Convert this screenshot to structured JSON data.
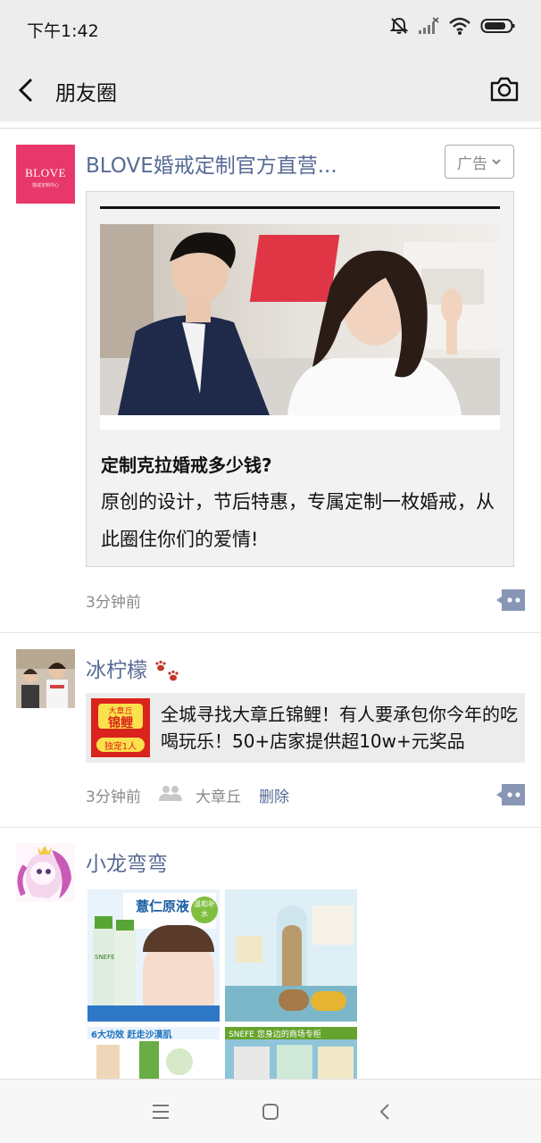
{
  "status_bar": {
    "time": "下午1:42",
    "icons": [
      "mute-bell-icon",
      "signal-icon",
      "wifi-icon",
      "battery-icon"
    ]
  },
  "nav": {
    "title": "朋友圈",
    "back_icon": "chevron-left-icon",
    "camera_icon": "camera-icon"
  },
  "posts": [
    {
      "avatar_brand": "BLOVE",
      "avatar_sub": "婚戒定制中心",
      "name": "BLOVE婚戒定制官方直营...",
      "ad_label": "广告",
      "ad_card": {
        "headline": "定制克拉婚戒多少钱?",
        "body": "原创的设计，节后特惠，专属定制一枚婚戒，从此圈住你们的爱情!"
      },
      "time": "3分钟前"
    },
    {
      "name": "冰柠檬",
      "name_emoji": "paw-prints-icon",
      "share": {
        "thumb_top": "大章丘",
        "thumb_main": "锦鲤",
        "thumb_bottom": "独宠1人",
        "text": "全城寻找大章丘锦鲤！有人要承包你今年的吃喝玩乐！50+店家提供超10w+元奖品"
      },
      "time": "3分钟前",
      "location": "大章丘",
      "delete_label": "删除"
    },
    {
      "name": "小龙弯弯",
      "images": [
        {
          "title": "薏仁原液",
          "badge": "温和补水",
          "brand": "SNEFE"
        },
        {
          "title": ""
        },
        {
          "title": "6大功效 赶走沙漠肌"
        },
        {
          "title": "SNEFE 您身边的商场专柜"
        }
      ]
    }
  ],
  "system_nav": [
    "menu-icon",
    "home-icon",
    "back-icon"
  ],
  "colors": {
    "link_blue": "#576b95",
    "header_bg": "#ededed",
    "blove_pink": "#e8386b"
  }
}
